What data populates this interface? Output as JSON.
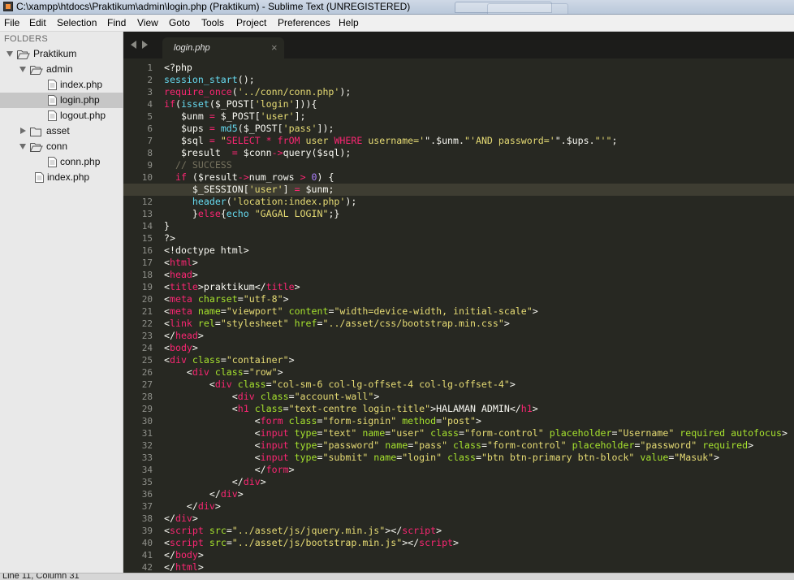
{
  "window": {
    "title": "C:\\xampp\\htdocs\\Praktikum\\admin\\login.php (Praktikum) - Sublime Text (UNREGISTERED)"
  },
  "menu": [
    "File",
    "Edit",
    "Selection",
    "Find",
    "View",
    "Goto",
    "Tools",
    "Project",
    "Preferences",
    "Help"
  ],
  "sidebar": {
    "header": "FOLDERS",
    "tree": [
      {
        "label": "Praktikum",
        "type": "folder",
        "open": true,
        "depth": 0
      },
      {
        "label": "admin",
        "type": "folder",
        "open": true,
        "depth": 1
      },
      {
        "label": "index.php",
        "type": "file",
        "depth": 2
      },
      {
        "label": "login.php",
        "type": "file",
        "depth": 2,
        "selected": true
      },
      {
        "label": "logout.php",
        "type": "file",
        "depth": 2
      },
      {
        "label": "asset",
        "type": "folder",
        "open": false,
        "depth": 1
      },
      {
        "label": "conn",
        "type": "folder",
        "open": true,
        "depth": 1
      },
      {
        "label": "conn.php",
        "type": "file",
        "depth": 2
      },
      {
        "label": "index.php",
        "type": "file",
        "depth": 1
      }
    ]
  },
  "tabs": [
    {
      "name": "login.php",
      "active": true
    }
  ],
  "editor": {
    "current_line": 11,
    "lines": [
      [
        [
          "<?php",
          ""
        ]
      ],
      [
        [
          "session_start",
          "f"
        ],
        [
          "();",
          ""
        ]
      ],
      [
        [
          "require_once",
          "k"
        ],
        [
          "(",
          ""
        ],
        [
          "'../conn/conn.php'",
          "s"
        ],
        [
          ");",
          ""
        ]
      ],
      [
        [
          "if",
          "k"
        ],
        [
          "(",
          ""
        ],
        [
          "isset",
          "f"
        ],
        [
          "($_POST[",
          ""
        ],
        [
          "'login'",
          "s"
        ],
        [
          "])){",
          ""
        ]
      ],
      [
        [
          "   $unm ",
          ""
        ],
        [
          "=",
          "k"
        ],
        [
          " $_POST[",
          ""
        ],
        [
          "'user'",
          "s"
        ],
        [
          "];",
          ""
        ]
      ],
      [
        [
          "   $ups ",
          ""
        ],
        [
          "=",
          "k"
        ],
        [
          " ",
          ""
        ],
        [
          "md5",
          "f"
        ],
        [
          "($_POST[",
          ""
        ],
        [
          "'pass'",
          "s"
        ],
        [
          "]);",
          ""
        ]
      ],
      [
        [
          "   $sql ",
          ""
        ],
        [
          "=",
          "k"
        ],
        [
          " ",
          ""
        ],
        [
          "\"",
          "s"
        ],
        [
          "SELECT * frOM",
          "k"
        ],
        [
          " user ",
          "s"
        ],
        [
          "WHERE",
          "k"
        ],
        [
          " username='",
          "s"
        ],
        [
          "\"",
          ""
        ],
        [
          ".$unm.",
          ""
        ],
        [
          "\"",
          "s"
        ],
        [
          "'AND password='",
          "s"
        ],
        [
          "\"",
          ""
        ],
        [
          ".$ups.",
          ""
        ],
        [
          "\"'\"",
          "s"
        ],
        [
          ";",
          ""
        ]
      ],
      [
        [
          "   $result  ",
          ""
        ],
        [
          "=",
          "k"
        ],
        [
          " $conn",
          ""
        ],
        [
          "->",
          "k"
        ],
        [
          "query($sql);",
          ""
        ]
      ],
      [
        [
          "  // SUCCESS",
          "c"
        ]
      ],
      [
        [
          "  ",
          ""
        ],
        [
          "if",
          "k"
        ],
        [
          " ($result",
          ""
        ],
        [
          "->",
          "k"
        ],
        [
          "num_rows ",
          ""
        ],
        [
          ">",
          "k"
        ],
        [
          " ",
          ""
        ],
        [
          "0",
          "n"
        ],
        [
          ") {",
          ""
        ]
      ],
      [
        [
          "     $_SESSION[",
          ""
        ],
        [
          "'user'",
          "s"
        ],
        [
          "] ",
          ""
        ],
        [
          "=",
          "k"
        ],
        [
          " $unm;",
          ""
        ]
      ],
      [
        [
          "     ",
          ""
        ],
        [
          "header",
          "f"
        ],
        [
          "(",
          ""
        ],
        [
          "'location:index.php'",
          "s"
        ],
        [
          ");",
          ""
        ]
      ],
      [
        [
          "     }",
          ""
        ],
        [
          "else",
          "k"
        ],
        [
          "{",
          ""
        ],
        [
          "echo",
          "f"
        ],
        [
          " ",
          ""
        ],
        [
          "\"GAGAL LOGIN\"",
          "s"
        ],
        [
          ";}",
          ""
        ]
      ],
      [
        [
          "}",
          ""
        ]
      ],
      [
        [
          "?>",
          ""
        ]
      ],
      [
        [
          "<!doctype html>",
          ""
        ]
      ],
      [
        [
          "<",
          ""
        ],
        [
          "html",
          "k"
        ],
        [
          ">",
          ""
        ]
      ],
      [
        [
          "<",
          ""
        ],
        [
          "head",
          "k"
        ],
        [
          ">",
          ""
        ]
      ],
      [
        [
          "<",
          ""
        ],
        [
          "title",
          "k"
        ],
        [
          ">praktikum</",
          ""
        ],
        [
          "title",
          "k"
        ],
        [
          ">",
          ""
        ]
      ],
      [
        [
          "<",
          ""
        ],
        [
          "meta",
          "k"
        ],
        [
          " ",
          ""
        ],
        [
          "charset",
          "a"
        ],
        [
          "=",
          ""
        ],
        [
          "\"utf-8\"",
          "s"
        ],
        [
          ">",
          ""
        ]
      ],
      [
        [
          "<",
          ""
        ],
        [
          "meta",
          "k"
        ],
        [
          " ",
          ""
        ],
        [
          "name",
          "a"
        ],
        [
          "=",
          ""
        ],
        [
          "\"viewport\"",
          "s"
        ],
        [
          " ",
          ""
        ],
        [
          "content",
          "a"
        ],
        [
          "=",
          ""
        ],
        [
          "\"width=device-width, initial-scale\"",
          "s"
        ],
        [
          ">",
          ""
        ]
      ],
      [
        [
          "<",
          ""
        ],
        [
          "link",
          "k"
        ],
        [
          " ",
          ""
        ],
        [
          "rel",
          "a"
        ],
        [
          "=",
          ""
        ],
        [
          "\"stylesheet\"",
          "s"
        ],
        [
          " ",
          ""
        ],
        [
          "href",
          "a"
        ],
        [
          "=",
          ""
        ],
        [
          "\"../asset/css/bootstrap.min.css\"",
          "s"
        ],
        [
          ">",
          ""
        ]
      ],
      [
        [
          "</",
          ""
        ],
        [
          "head",
          "k"
        ],
        [
          ">",
          ""
        ]
      ],
      [
        [
          "<",
          ""
        ],
        [
          "body",
          "k"
        ],
        [
          ">",
          ""
        ]
      ],
      [
        [
          "<",
          ""
        ],
        [
          "div",
          "k"
        ],
        [
          " ",
          ""
        ],
        [
          "class",
          "a"
        ],
        [
          "=",
          ""
        ],
        [
          "\"container\"",
          "s"
        ],
        [
          ">",
          ""
        ]
      ],
      [
        [
          "    <",
          ""
        ],
        [
          "div",
          "k"
        ],
        [
          " ",
          ""
        ],
        [
          "class",
          "a"
        ],
        [
          "=",
          ""
        ],
        [
          "\"row\"",
          "s"
        ],
        [
          ">",
          ""
        ]
      ],
      [
        [
          "        <",
          ""
        ],
        [
          "div",
          "k"
        ],
        [
          " ",
          ""
        ],
        [
          "class",
          "a"
        ],
        [
          "=",
          ""
        ],
        [
          "\"col-sm-6 col-lg-offset-4 col-lg-offset-4\"",
          "s"
        ],
        [
          ">",
          ""
        ]
      ],
      [
        [
          "            <",
          ""
        ],
        [
          "div",
          "k"
        ],
        [
          " ",
          ""
        ],
        [
          "class",
          "a"
        ],
        [
          "=",
          ""
        ],
        [
          "\"account-wall\"",
          "s"
        ],
        [
          ">",
          ""
        ]
      ],
      [
        [
          "            <",
          ""
        ],
        [
          "h1",
          "k"
        ],
        [
          " ",
          ""
        ],
        [
          "class",
          "a"
        ],
        [
          "=",
          ""
        ],
        [
          "\"text-centre login-title\"",
          "s"
        ],
        [
          ">HALAMAN ADMIN</",
          ""
        ],
        [
          "h1",
          "k"
        ],
        [
          ">",
          ""
        ]
      ],
      [
        [
          "                <",
          ""
        ],
        [
          "form",
          "k"
        ],
        [
          " ",
          ""
        ],
        [
          "class",
          "a"
        ],
        [
          "=",
          ""
        ],
        [
          "\"form-signin\"",
          "s"
        ],
        [
          " ",
          ""
        ],
        [
          "method",
          "a"
        ],
        [
          "=",
          ""
        ],
        [
          "\"post\"",
          "s"
        ],
        [
          ">",
          ""
        ]
      ],
      [
        [
          "                <",
          ""
        ],
        [
          "input",
          "k"
        ],
        [
          " ",
          ""
        ],
        [
          "type",
          "a"
        ],
        [
          "=",
          ""
        ],
        [
          "\"text\"",
          "s"
        ],
        [
          " ",
          ""
        ],
        [
          "name",
          "a"
        ],
        [
          "=",
          ""
        ],
        [
          "\"user\"",
          "s"
        ],
        [
          " ",
          ""
        ],
        [
          "class",
          "a"
        ],
        [
          "=",
          ""
        ],
        [
          "\"form-control\"",
          "s"
        ],
        [
          " ",
          ""
        ],
        [
          "placeholder",
          "a"
        ],
        [
          "=",
          ""
        ],
        [
          "\"Username\"",
          "s"
        ],
        [
          " ",
          ""
        ],
        [
          "required",
          "a"
        ],
        [
          " ",
          ""
        ],
        [
          "autofocus",
          "a"
        ],
        [
          ">",
          ""
        ]
      ],
      [
        [
          "                <",
          ""
        ],
        [
          "input",
          "k"
        ],
        [
          " ",
          ""
        ],
        [
          "type",
          "a"
        ],
        [
          "=",
          ""
        ],
        [
          "\"password\"",
          "s"
        ],
        [
          " ",
          ""
        ],
        [
          "name",
          "a"
        ],
        [
          "=",
          ""
        ],
        [
          "\"pass\"",
          "s"
        ],
        [
          " ",
          ""
        ],
        [
          "class",
          "a"
        ],
        [
          "=",
          ""
        ],
        [
          "\"form-control\"",
          "s"
        ],
        [
          " ",
          ""
        ],
        [
          "placeholder",
          "a"
        ],
        [
          "=",
          ""
        ],
        [
          "\"password\"",
          "s"
        ],
        [
          " ",
          ""
        ],
        [
          "required",
          "a"
        ],
        [
          ">",
          ""
        ]
      ],
      [
        [
          "                <",
          ""
        ],
        [
          "input",
          "k"
        ],
        [
          " ",
          ""
        ],
        [
          "type",
          "a"
        ],
        [
          "=",
          ""
        ],
        [
          "\"submit\"",
          "s"
        ],
        [
          " ",
          ""
        ],
        [
          "name",
          "a"
        ],
        [
          "=",
          ""
        ],
        [
          "\"login\"",
          "s"
        ],
        [
          " ",
          ""
        ],
        [
          "class",
          "a"
        ],
        [
          "=",
          ""
        ],
        [
          "\"btn btn-primary btn-block\"",
          "s"
        ],
        [
          " ",
          ""
        ],
        [
          "value",
          "a"
        ],
        [
          "=",
          ""
        ],
        [
          "\"Masuk\"",
          "s"
        ],
        [
          ">",
          ""
        ]
      ],
      [
        [
          "                </",
          ""
        ],
        [
          "form",
          "k"
        ],
        [
          ">",
          ""
        ]
      ],
      [
        [
          "            </",
          ""
        ],
        [
          "div",
          "k"
        ],
        [
          ">",
          ""
        ]
      ],
      [
        [
          "        </",
          ""
        ],
        [
          "div",
          "k"
        ],
        [
          ">",
          ""
        ]
      ],
      [
        [
          "    </",
          ""
        ],
        [
          "div",
          "k"
        ],
        [
          ">",
          ""
        ]
      ],
      [
        [
          "</",
          ""
        ],
        [
          "div",
          "k"
        ],
        [
          ">",
          ""
        ]
      ],
      [
        [
          "<",
          ""
        ],
        [
          "script",
          "k"
        ],
        [
          " ",
          ""
        ],
        [
          "src",
          "a"
        ],
        [
          "=",
          ""
        ],
        [
          "\"../asset/js/jquery.min.js\"",
          "s"
        ],
        [
          "></",
          ""
        ],
        [
          "script",
          "k"
        ],
        [
          ">",
          ""
        ]
      ],
      [
        [
          "<",
          ""
        ],
        [
          "script",
          "k"
        ],
        [
          " ",
          ""
        ],
        [
          "src",
          "a"
        ],
        [
          "=",
          ""
        ],
        [
          "\"../asset/js/bootstrap.min.js\"",
          "s"
        ],
        [
          "></",
          ""
        ],
        [
          "script",
          "k"
        ],
        [
          ">",
          ""
        ]
      ],
      [
        [
          "</",
          ""
        ],
        [
          "body",
          "k"
        ],
        [
          ">",
          ""
        ]
      ],
      [
        [
          "</",
          ""
        ],
        [
          "html",
          "k"
        ],
        [
          ">",
          ""
        ]
      ]
    ]
  },
  "status": {
    "text": "Line 11, Column 31"
  },
  "colors": {
    "editor_bg": "#272822",
    "keyword": "#f92672",
    "function": "#66d9ef",
    "string": "#e6db74",
    "comment": "#75715e",
    "attribute": "#a6e22e",
    "number": "#ae81ff"
  }
}
